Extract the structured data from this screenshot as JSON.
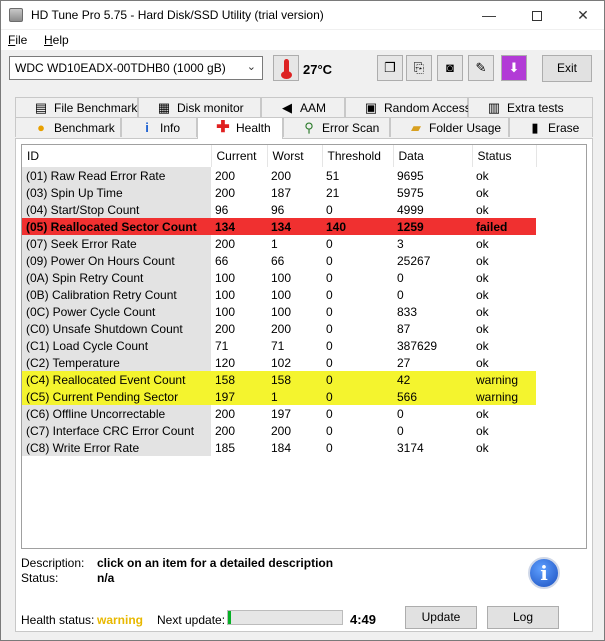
{
  "window": {
    "title": "HD Tune Pro 5.75 - Hard Disk/SSD Utility (trial version)",
    "minimize": "—",
    "close": "✕"
  },
  "menu": {
    "file_ul": "F",
    "file_rest": "ile",
    "help_ul": "H",
    "help_rest": "elp"
  },
  "toolbar": {
    "drive": "WDC WD10EADX-00TDHB0 (1000 gB)",
    "temperature": "27°C",
    "exit_label": "Exit",
    "icons": [
      "copy-text-icon",
      "copy-info-icon",
      "screenshot-icon",
      "options-icon",
      "save-icon"
    ]
  },
  "tabs": {
    "row1": [
      {
        "label": "File Benchmark",
        "icon": "file-benchmark-icon"
      },
      {
        "label": "Disk monitor",
        "icon": "disk-monitor-icon"
      },
      {
        "label": "AAM",
        "icon": "speaker-icon"
      },
      {
        "label": "Random Access",
        "icon": "random-access-icon"
      },
      {
        "label": "Extra tests",
        "icon": "extra-tests-icon"
      }
    ],
    "row2": [
      {
        "label": "Benchmark",
        "icon": "benchmark-icon"
      },
      {
        "label": "Info",
        "icon": "info-tab-icon"
      },
      {
        "label": "Health",
        "icon": "health-cross-icon"
      },
      {
        "label": "Error Scan",
        "icon": "magnifier-icon"
      },
      {
        "label": "Folder Usage",
        "icon": "folder-icon"
      },
      {
        "label": "Erase",
        "icon": "erase-icon"
      }
    ],
    "active": "Health"
  },
  "smart": {
    "columns": [
      "ID",
      "Current",
      "Worst",
      "Threshold",
      "Data",
      "Status"
    ],
    "rows": [
      {
        "id": "(01) Raw Read Error Rate",
        "current": "200",
        "worst": "200",
        "threshold": "51",
        "data": "9695",
        "status": "ok",
        "level": "ok"
      },
      {
        "id": "(03) Spin Up Time",
        "current": "200",
        "worst": "187",
        "threshold": "21",
        "data": "5975",
        "status": "ok",
        "level": "ok"
      },
      {
        "id": "(04) Start/Stop Count",
        "current": "96",
        "worst": "96",
        "threshold": "0",
        "data": "4999",
        "status": "ok",
        "level": "ok"
      },
      {
        "id": "(05) Reallocated Sector Count",
        "current": "134",
        "worst": "134",
        "threshold": "140",
        "data": "1259",
        "status": "failed",
        "level": "failed"
      },
      {
        "id": "(07) Seek Error Rate",
        "current": "200",
        "worst": "1",
        "threshold": "0",
        "data": "3",
        "status": "ok",
        "level": "ok"
      },
      {
        "id": "(09) Power On Hours Count",
        "current": "66",
        "worst": "66",
        "threshold": "0",
        "data": "25267",
        "status": "ok",
        "level": "ok"
      },
      {
        "id": "(0A) Spin Retry Count",
        "current": "100",
        "worst": "100",
        "threshold": "0",
        "data": "0",
        "status": "ok",
        "level": "ok"
      },
      {
        "id": "(0B) Calibration Retry Count",
        "current": "100",
        "worst": "100",
        "threshold": "0",
        "data": "0",
        "status": "ok",
        "level": "ok"
      },
      {
        "id": "(0C) Power Cycle Count",
        "current": "100",
        "worst": "100",
        "threshold": "0",
        "data": "833",
        "status": "ok",
        "level": "ok"
      },
      {
        "id": "(C0) Unsafe Shutdown Count",
        "current": "200",
        "worst": "200",
        "threshold": "0",
        "data": "87",
        "status": "ok",
        "level": "ok"
      },
      {
        "id": "(C1) Load Cycle Count",
        "current": "71",
        "worst": "71",
        "threshold": "0",
        "data": "387629",
        "status": "ok",
        "level": "ok"
      },
      {
        "id": "(C2) Temperature",
        "current": "120",
        "worst": "102",
        "threshold": "0",
        "data": "27",
        "status": "ok",
        "level": "ok"
      },
      {
        "id": "(C4) Reallocated Event Count",
        "current": "158",
        "worst": "158",
        "threshold": "0",
        "data": "42",
        "status": "warning",
        "level": "warning"
      },
      {
        "id": "(C5) Current Pending Sector",
        "current": "197",
        "worst": "1",
        "threshold": "0",
        "data": "566",
        "status": "warning",
        "level": "warning"
      },
      {
        "id": "(C6) Offline Uncorrectable",
        "current": "200",
        "worst": "197",
        "threshold": "0",
        "data": "0",
        "status": "ok",
        "level": "ok"
      },
      {
        "id": "(C7) Interface CRC Error Count",
        "current": "200",
        "worst": "200",
        "threshold": "0",
        "data": "0",
        "status": "ok",
        "level": "ok"
      },
      {
        "id": "(C8) Write Error Rate",
        "current": "185",
        "worst": "184",
        "threshold": "0",
        "data": "3174",
        "status": "ok",
        "level": "ok"
      }
    ]
  },
  "details": {
    "description_label": "Description:",
    "description_value": "click on an item for a detailed description",
    "status_label": "Status:",
    "status_value": "n/a"
  },
  "footer": {
    "health_label": "Health status:",
    "health_value": "warning",
    "health_color": "#e8b800",
    "next_update_label": "Next update:",
    "next_update_progress": 0.03,
    "timer": "4:49",
    "update_label": "Update",
    "log_label": "Log"
  },
  "colors": {
    "failed_row": "#f03030",
    "warning_row": "#f4f42e",
    "progress_fill": "#06b025"
  }
}
